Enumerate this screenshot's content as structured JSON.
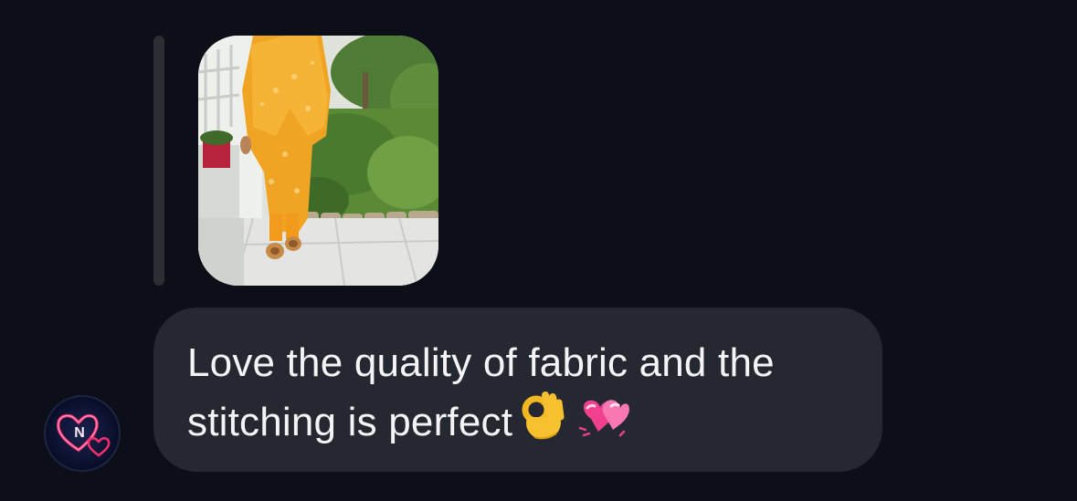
{
  "conversation": {
    "replied_media": {
      "description_icon": "photo-thumbnail"
    },
    "message": {
      "text": "Love the quality of fabric and the stitching is perfect",
      "emojis": [
        "ok-hand-emoji",
        "two-hearts-emoji"
      ]
    },
    "sender_avatar": {
      "letter": "N",
      "icon": "neon-heart-icon"
    }
  },
  "colors": {
    "background": "#0c0f18",
    "bubble": "#252831",
    "reply_bar": "#2b2e35",
    "text": "#f3f4f6",
    "neon_pink": "#ff2e6e"
  }
}
